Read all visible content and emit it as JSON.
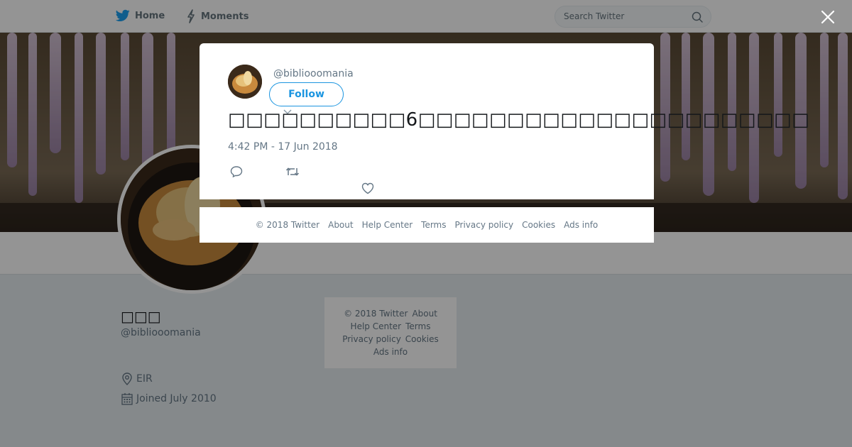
{
  "nav": {
    "home_label": "Home",
    "moments_label": "Moments",
    "search_placeholder": "Search Twitter"
  },
  "profile": {
    "name": "□□□",
    "handle": "@bibliooomania",
    "location": "EIR",
    "joined": "Joined July 2010"
  },
  "side_footer": {
    "copyright": "© 2018 Twitter",
    "about": "About",
    "help_center": "Help Center",
    "terms": "Terms",
    "privacy": "Privacy policy",
    "cookies": "Cookies",
    "ads_info": "Ads info"
  },
  "tweet": {
    "handle": "@bibliooomania",
    "follow_label": "Follow",
    "text": "□□□□□□□□□□6□□□□□□□□□□□□□□□□□□□□□□",
    "timestamp": "4:42 PM - 17 Jun 2018"
  },
  "modal_footer": {
    "copyright": "© 2018 Twitter",
    "about": "About",
    "help_center": "Help Center",
    "terms": "Terms",
    "privacy": "Privacy policy",
    "cookies": "Cookies",
    "ads_info": "Ads info"
  },
  "colors": {
    "accent": "#1b95e0",
    "secondary_text": "#657786",
    "page_bg": "#e6ecf0"
  },
  "icons": [
    "twitter-bird-icon",
    "lightning-icon",
    "search-icon",
    "close-icon",
    "location-pin-icon",
    "calendar-icon",
    "reply-icon",
    "retweet-icon",
    "heart-icon",
    "caret-down-icon"
  ]
}
